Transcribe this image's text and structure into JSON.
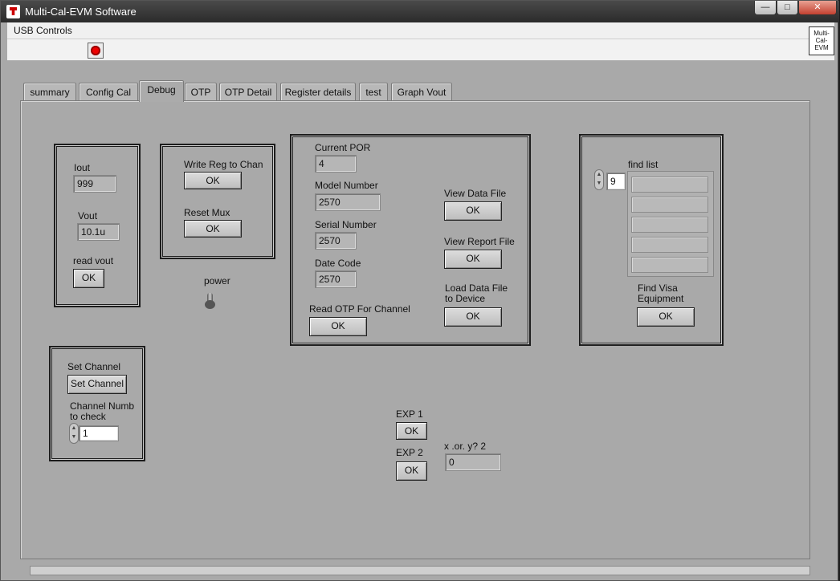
{
  "window": {
    "title": "Multi-Cal-EVM Software",
    "minimize": "—",
    "maximize": "□",
    "close": "✕"
  },
  "menu": {
    "usb_controls": "USB Controls"
  },
  "corner_logo": {
    "line1": "Multi-",
    "line2": "Cal-",
    "line3": "EVM"
  },
  "tabs": [
    {
      "label": "summary"
    },
    {
      "label": "Config Cal"
    },
    {
      "label": "Debug",
      "active": true
    },
    {
      "label": "OTP"
    },
    {
      "label": "OTP Detail"
    },
    {
      "label": "Register details"
    },
    {
      "label": "test"
    },
    {
      "label": "Graph Vout"
    }
  ],
  "iout_group": {
    "iout_label": "Iout",
    "iout_value": "999",
    "vout_label": "Vout",
    "vout_value": "10.1u",
    "read_vout_label": "read vout",
    "read_vout_button": "OK"
  },
  "reg_group": {
    "write_reg_label": "Write Reg to Chan",
    "write_reg_button": "OK",
    "reset_mux_label": "Reset Mux",
    "reset_mux_button": "OK"
  },
  "power": {
    "label": "power",
    "state": "off"
  },
  "otp_group": {
    "current_por_label": "Current POR",
    "current_por_value": "4",
    "model_number_label": "Model Number",
    "model_number_value": "2570",
    "serial_number_label": "Serial Number",
    "serial_number_value": "2570",
    "date_code_label": "Date Code",
    "date_code_value": "2570",
    "read_otp_label": "Read OTP For Channel",
    "read_otp_button": "OK",
    "view_data_label": "View Data File",
    "view_data_button": "OK",
    "view_report_label": "View Report File",
    "view_report_button": "OK",
    "load_data_label_1": "Load Data File",
    "load_data_label_2": "to Device",
    "load_data_button": "OK"
  },
  "visa_group": {
    "find_list_label": "find list",
    "find_list_index": "9",
    "find_list_items": [
      "",
      "",
      "",
      "",
      ""
    ],
    "find_visa_label_1": "Find Visa",
    "find_visa_label_2": "Equipment",
    "find_visa_button": "OK"
  },
  "channel_group": {
    "set_channel_label": "Set Channel",
    "set_channel_button": "Set Channel",
    "channel_numb_label_1": "Channel Numb",
    "channel_numb_label_2": "to check",
    "channel_numb_value": "1"
  },
  "exp": {
    "exp1_label": "EXP 1",
    "exp1_button": "OK",
    "exp2_label": "EXP 2",
    "exp2_button": "OK",
    "xory_label": "x .or. y? 2",
    "xory_value": "0"
  }
}
